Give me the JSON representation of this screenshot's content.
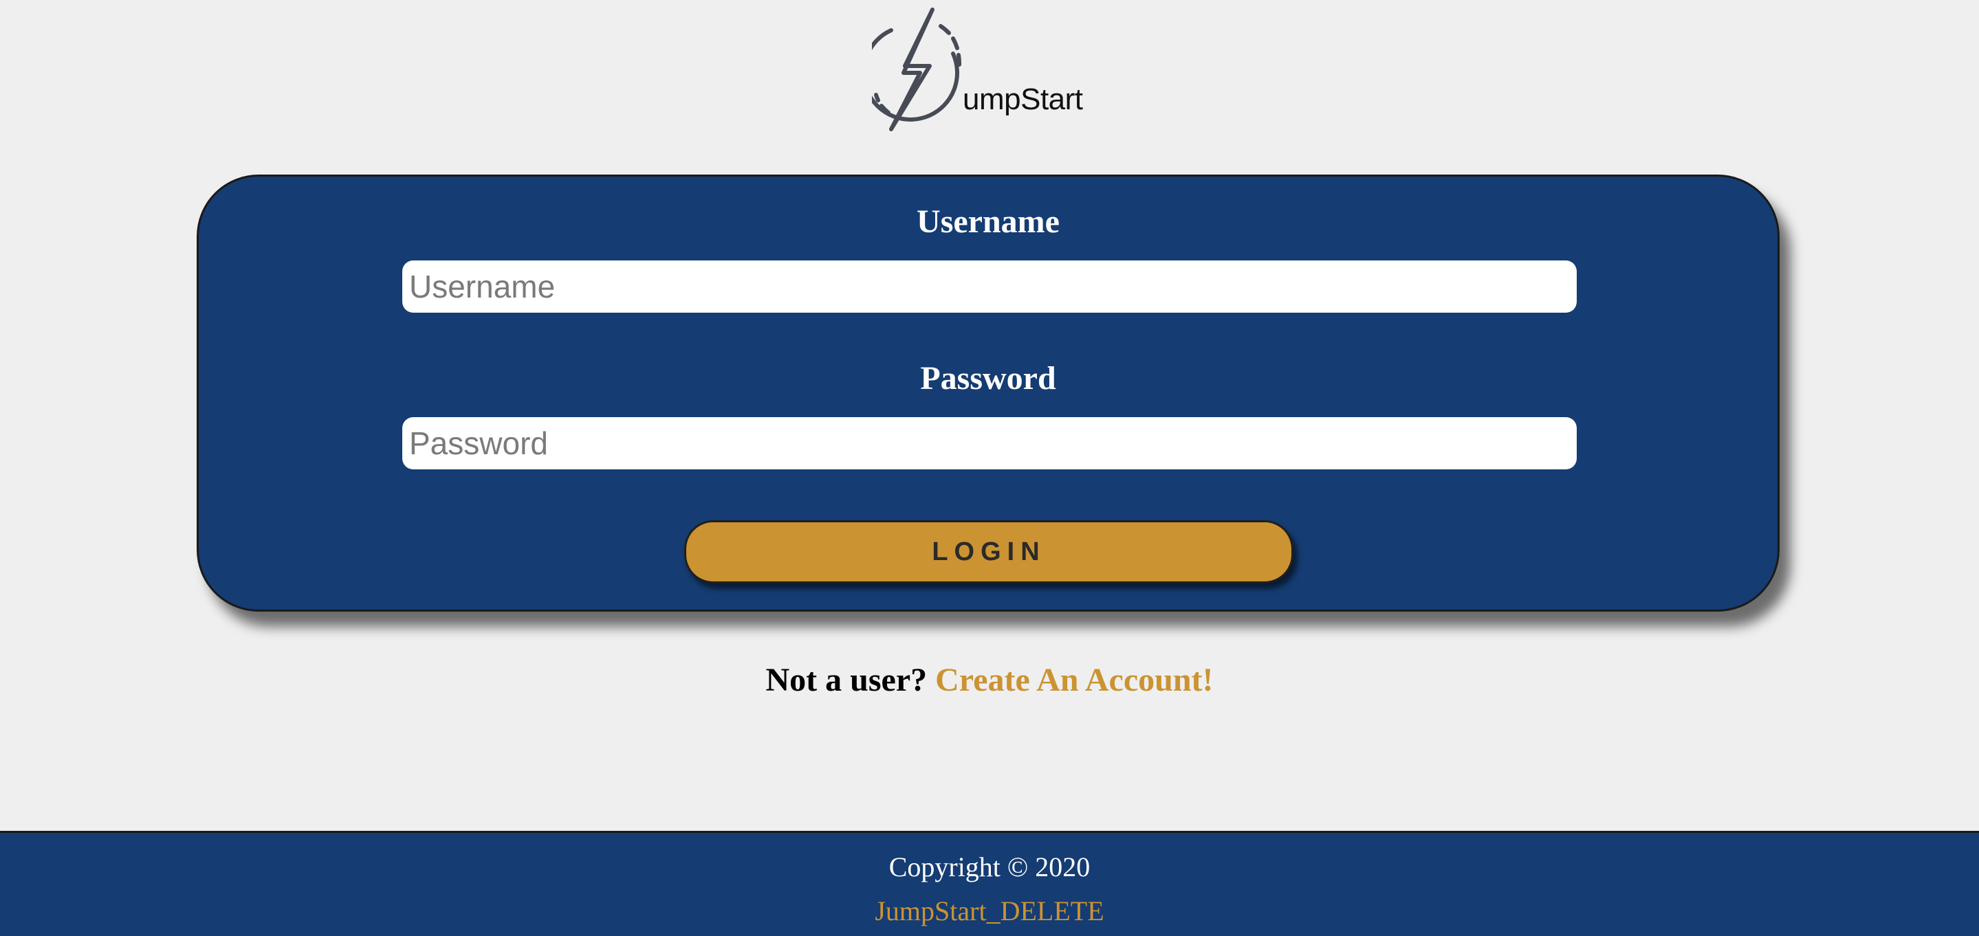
{
  "logo": {
    "text": "umpStart",
    "icon": "lightning-bolt-circle-icon"
  },
  "login_form": {
    "username_label": "Username",
    "username_placeholder": "Username",
    "username_value": "",
    "password_label": "Password",
    "password_placeholder": "Password",
    "password_value": "",
    "login_button_label": "LOGIN"
  },
  "signup": {
    "prompt": "Not a user?",
    "link_text": "Create An Account!"
  },
  "footer": {
    "copyright": "Copyright © 2020",
    "link_text": "JumpStart_DELETE"
  },
  "colors": {
    "background": "#efefef",
    "primary_blue": "#153c73",
    "accent_gold": "#cb9332",
    "text_white": "#ffffff"
  }
}
